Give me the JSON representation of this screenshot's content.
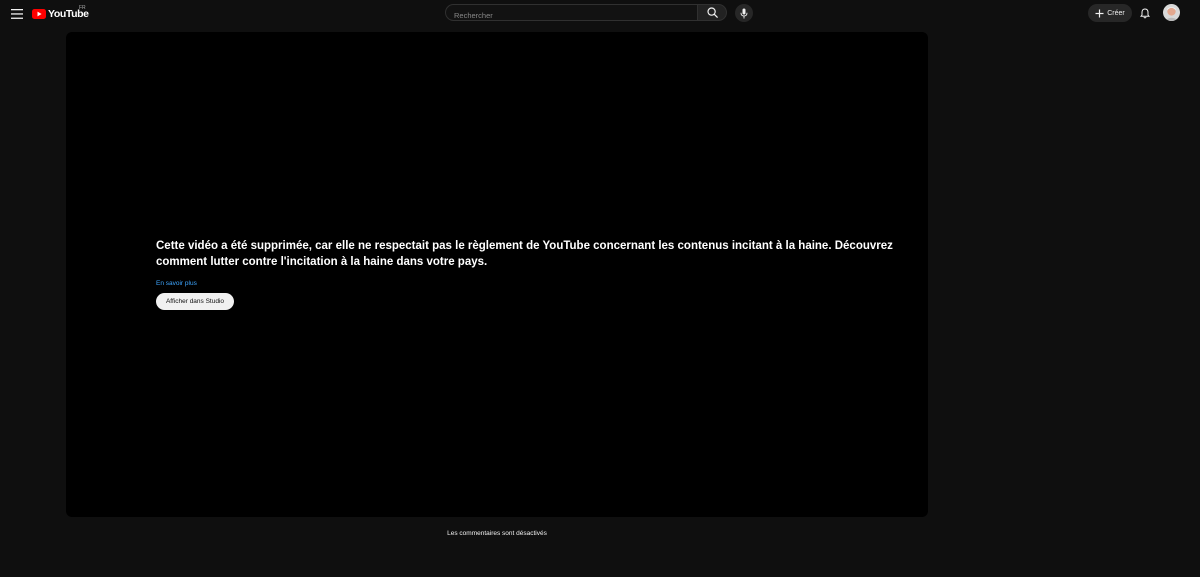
{
  "header": {
    "logo_text": "YouTube",
    "country_code": "FR",
    "search": {
      "placeholder": "Rechercher",
      "value": ""
    },
    "create_label": "Créer",
    "icons": {
      "menu": "hamburger-menu-icon",
      "search": "search-icon",
      "mic": "microphone-icon",
      "create": "plus-icon",
      "notifications": "bell-icon",
      "avatar": "user-avatar"
    }
  },
  "player": {
    "error_message": "Cette vidéo a été supprimée, car elle ne respectait pas le règlement de YouTube concernant les contenus incitant à la haine. Découvrez comment lutter contre l'incitation à la haine dans votre pays.",
    "learn_more_label": "En savoir plus",
    "studio_button_label": "Afficher dans Studio"
  },
  "comments": {
    "status": "Les commentaires sont désactivés"
  },
  "colors": {
    "page_background": "#0f0f0f",
    "player_background": "#000000",
    "brand_red": "#ff0000",
    "link_blue": "#3ea6ff",
    "chip_background": "#272727"
  }
}
